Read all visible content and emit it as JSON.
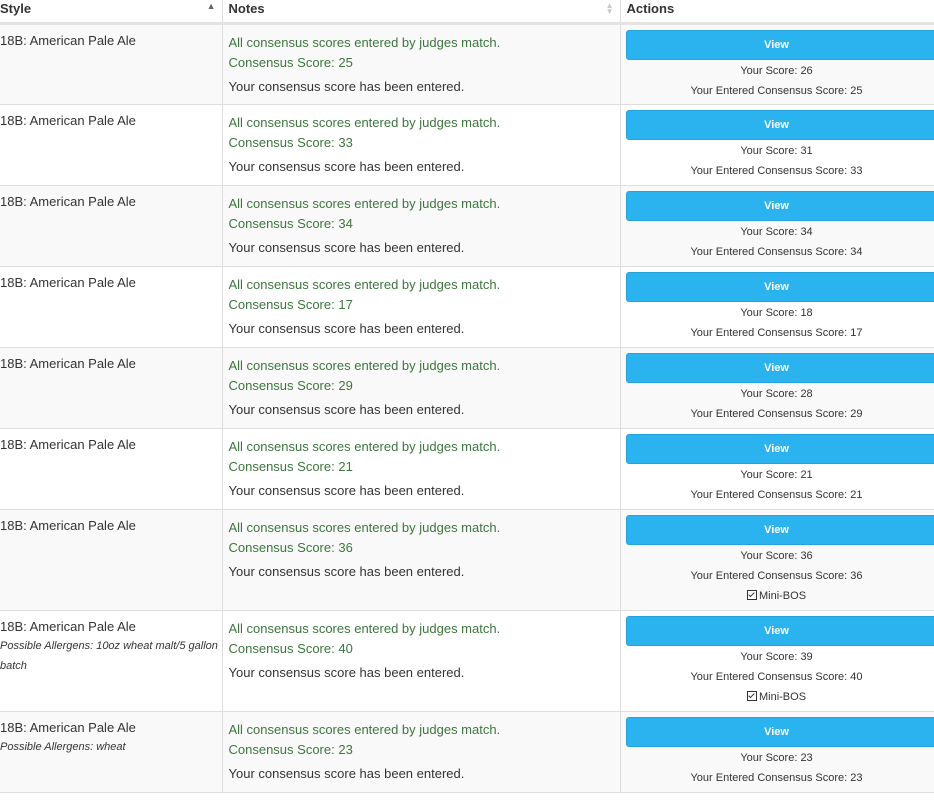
{
  "table": {
    "headers": {
      "style": "Style",
      "notes": "Notes",
      "actions": "Actions"
    },
    "rows": [
      {
        "style": "18B: American Pale Ale",
        "allergens": "",
        "match": "All consensus scores entered by judges match.",
        "consensus": "Consensus Score: 25",
        "entered": "Your consensus score has been entered.",
        "button": "View",
        "your_score": "Your Score: 26",
        "entered_consensus": "Your Entered Consensus Score: 25",
        "mini_bos": ""
      },
      {
        "style": "18B: American Pale Ale",
        "allergens": "",
        "match": "All consensus scores entered by judges match.",
        "consensus": "Consensus Score: 33",
        "entered": "Your consensus score has been entered.",
        "button": "View",
        "your_score": "Your Score: 31",
        "entered_consensus": "Your Entered Consensus Score: 33",
        "mini_bos": ""
      },
      {
        "style": "18B: American Pale Ale",
        "allergens": "",
        "match": "All consensus scores entered by judges match.",
        "consensus": "Consensus Score: 34",
        "entered": "Your consensus score has been entered.",
        "button": "View",
        "your_score": "Your Score: 34",
        "entered_consensus": "Your Entered Consensus Score: 34",
        "mini_bos": ""
      },
      {
        "style": "18B: American Pale Ale",
        "allergens": "",
        "match": "All consensus scores entered by judges match.",
        "consensus": "Consensus Score: 17",
        "entered": "Your consensus score has been entered.",
        "button": "View",
        "your_score": "Your Score: 18",
        "entered_consensus": "Your Entered Consensus Score: 17",
        "mini_bos": ""
      },
      {
        "style": "18B: American Pale Ale",
        "allergens": "",
        "match": "All consensus scores entered by judges match.",
        "consensus": "Consensus Score: 29",
        "entered": "Your consensus score has been entered.",
        "button": "View",
        "your_score": "Your Score: 28",
        "entered_consensus": "Your Entered Consensus Score: 29",
        "mini_bos": ""
      },
      {
        "style": "18B: American Pale Ale",
        "allergens": "",
        "match": "All consensus scores entered by judges match.",
        "consensus": "Consensus Score: 21",
        "entered": "Your consensus score has been entered.",
        "button": "View",
        "your_score": "Your Score: 21",
        "entered_consensus": "Your Entered Consensus Score: 21",
        "mini_bos": ""
      },
      {
        "style": "18B: American Pale Ale",
        "allergens": "",
        "match": "All consensus scores entered by judges match.",
        "consensus": "Consensus Score: 36",
        "entered": "Your consensus score has been entered.",
        "button": "View",
        "your_score": "Your Score: 36",
        "entered_consensus": "Your Entered Consensus Score: 36",
        "mini_bos": "Mini-BOS"
      },
      {
        "style": "18B: American Pale Ale",
        "allergens": "Possible Allergens: 10oz wheat malt/5 gallon batch",
        "match": "All consensus scores entered by judges match.",
        "consensus": "Consensus Score: 40",
        "entered": "Your consensus score has been entered.",
        "button": "View",
        "your_score": "Your Score: 39",
        "entered_consensus": "Your Entered Consensus Score: 40",
        "mini_bos": "Mini-BOS"
      },
      {
        "style": "18B: American Pale Ale",
        "allergens": "Possible Allergens: wheat",
        "match": "All consensus scores entered by judges match.",
        "consensus": "Consensus Score: 23",
        "entered": "Your consensus score has been entered.",
        "button": "View",
        "your_score": "Your Score: 23",
        "entered_consensus": "Your Entered Consensus Score: 23",
        "mini_bos": ""
      }
    ]
  },
  "icons": {
    "sort_asc": "sort-ascending-icon",
    "sort_both": "sort-both-icon",
    "checkbox": "checked-checkbox-icon"
  },
  "colors": {
    "button": "#2bb3f0",
    "success_text": "#3c763d",
    "stripe": "#f9f9f9"
  }
}
